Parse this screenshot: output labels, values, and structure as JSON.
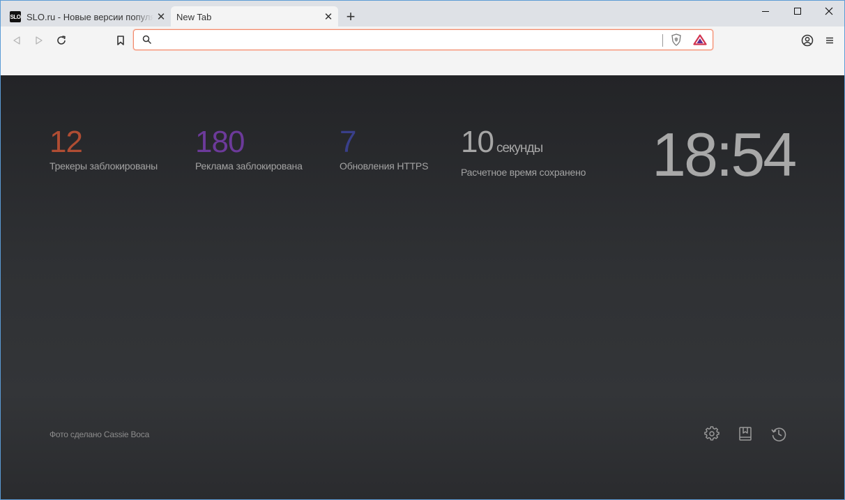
{
  "tabs": [
    {
      "favicon_text": "SLO",
      "title": "SLO.ru - Новые версии популярных программ",
      "close": "✕"
    },
    {
      "title": "New Tab",
      "close": "✕"
    }
  ],
  "newtab_label": "+",
  "window_controls": {
    "minimize": "—",
    "maximize": "☐",
    "close": "✕"
  },
  "toolbar": {
    "back_icon": "back-icon",
    "forward_icon": "forward-icon",
    "reload_icon": "reload-icon",
    "bookmark_icon": "bookmark-icon"
  },
  "urlbar": {
    "value": "",
    "placeholder": ""
  },
  "stats": [
    {
      "number": "12",
      "unit": "",
      "label": "Трекеры заблокированы",
      "color": "#b04d33"
    },
    {
      "number": "180",
      "unit": "",
      "label": "Реклама заблокирована",
      "color": "#6c3a9a"
    },
    {
      "number": "7",
      "unit": "",
      "label": "Обновления HTTPS",
      "color": "#393f8a"
    },
    {
      "number": "10",
      "unit": "секунды",
      "label": "Расчетное время сохранено",
      "color": "#a6a6a6"
    }
  ],
  "clock": "18:54",
  "photo_credit": "Фото сделано Cassie Boca",
  "ntp_buttons": [
    "gear-icon",
    "bookmarks-icon",
    "history-icon"
  ],
  "colors": {
    "accent": "#f08a6c",
    "background": "#2f3134"
  }
}
